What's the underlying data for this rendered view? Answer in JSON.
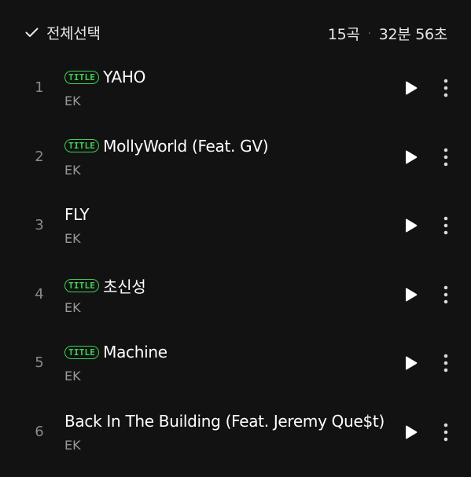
{
  "header": {
    "select_all_label": "전체선택",
    "song_count": "15곡",
    "separator": "·",
    "duration": "32분 56초"
  },
  "colors": {
    "background": "#121212",
    "accent_green": "#3ecf57",
    "text_primary": "#ffffff",
    "text_secondary": "#9a9a9a"
  },
  "tracks": [
    {
      "rank": "1",
      "badge": "TITLE",
      "title": "YAHO",
      "artist": "EK"
    },
    {
      "rank": "2",
      "badge": "TITLE",
      "title": "MollyWorld (Feat. GV)",
      "artist": "EK"
    },
    {
      "rank": "3",
      "badge": "",
      "title": "FLY",
      "artist": "EK"
    },
    {
      "rank": "4",
      "badge": "TITLE",
      "title": "초신성",
      "artist": "EK"
    },
    {
      "rank": "5",
      "badge": "TITLE",
      "title": "Machine",
      "artist": "EK"
    },
    {
      "rank": "6",
      "badge": "",
      "title": "Back In The Building (Feat. Jeremy Que$t)",
      "artist": "EK"
    }
  ]
}
